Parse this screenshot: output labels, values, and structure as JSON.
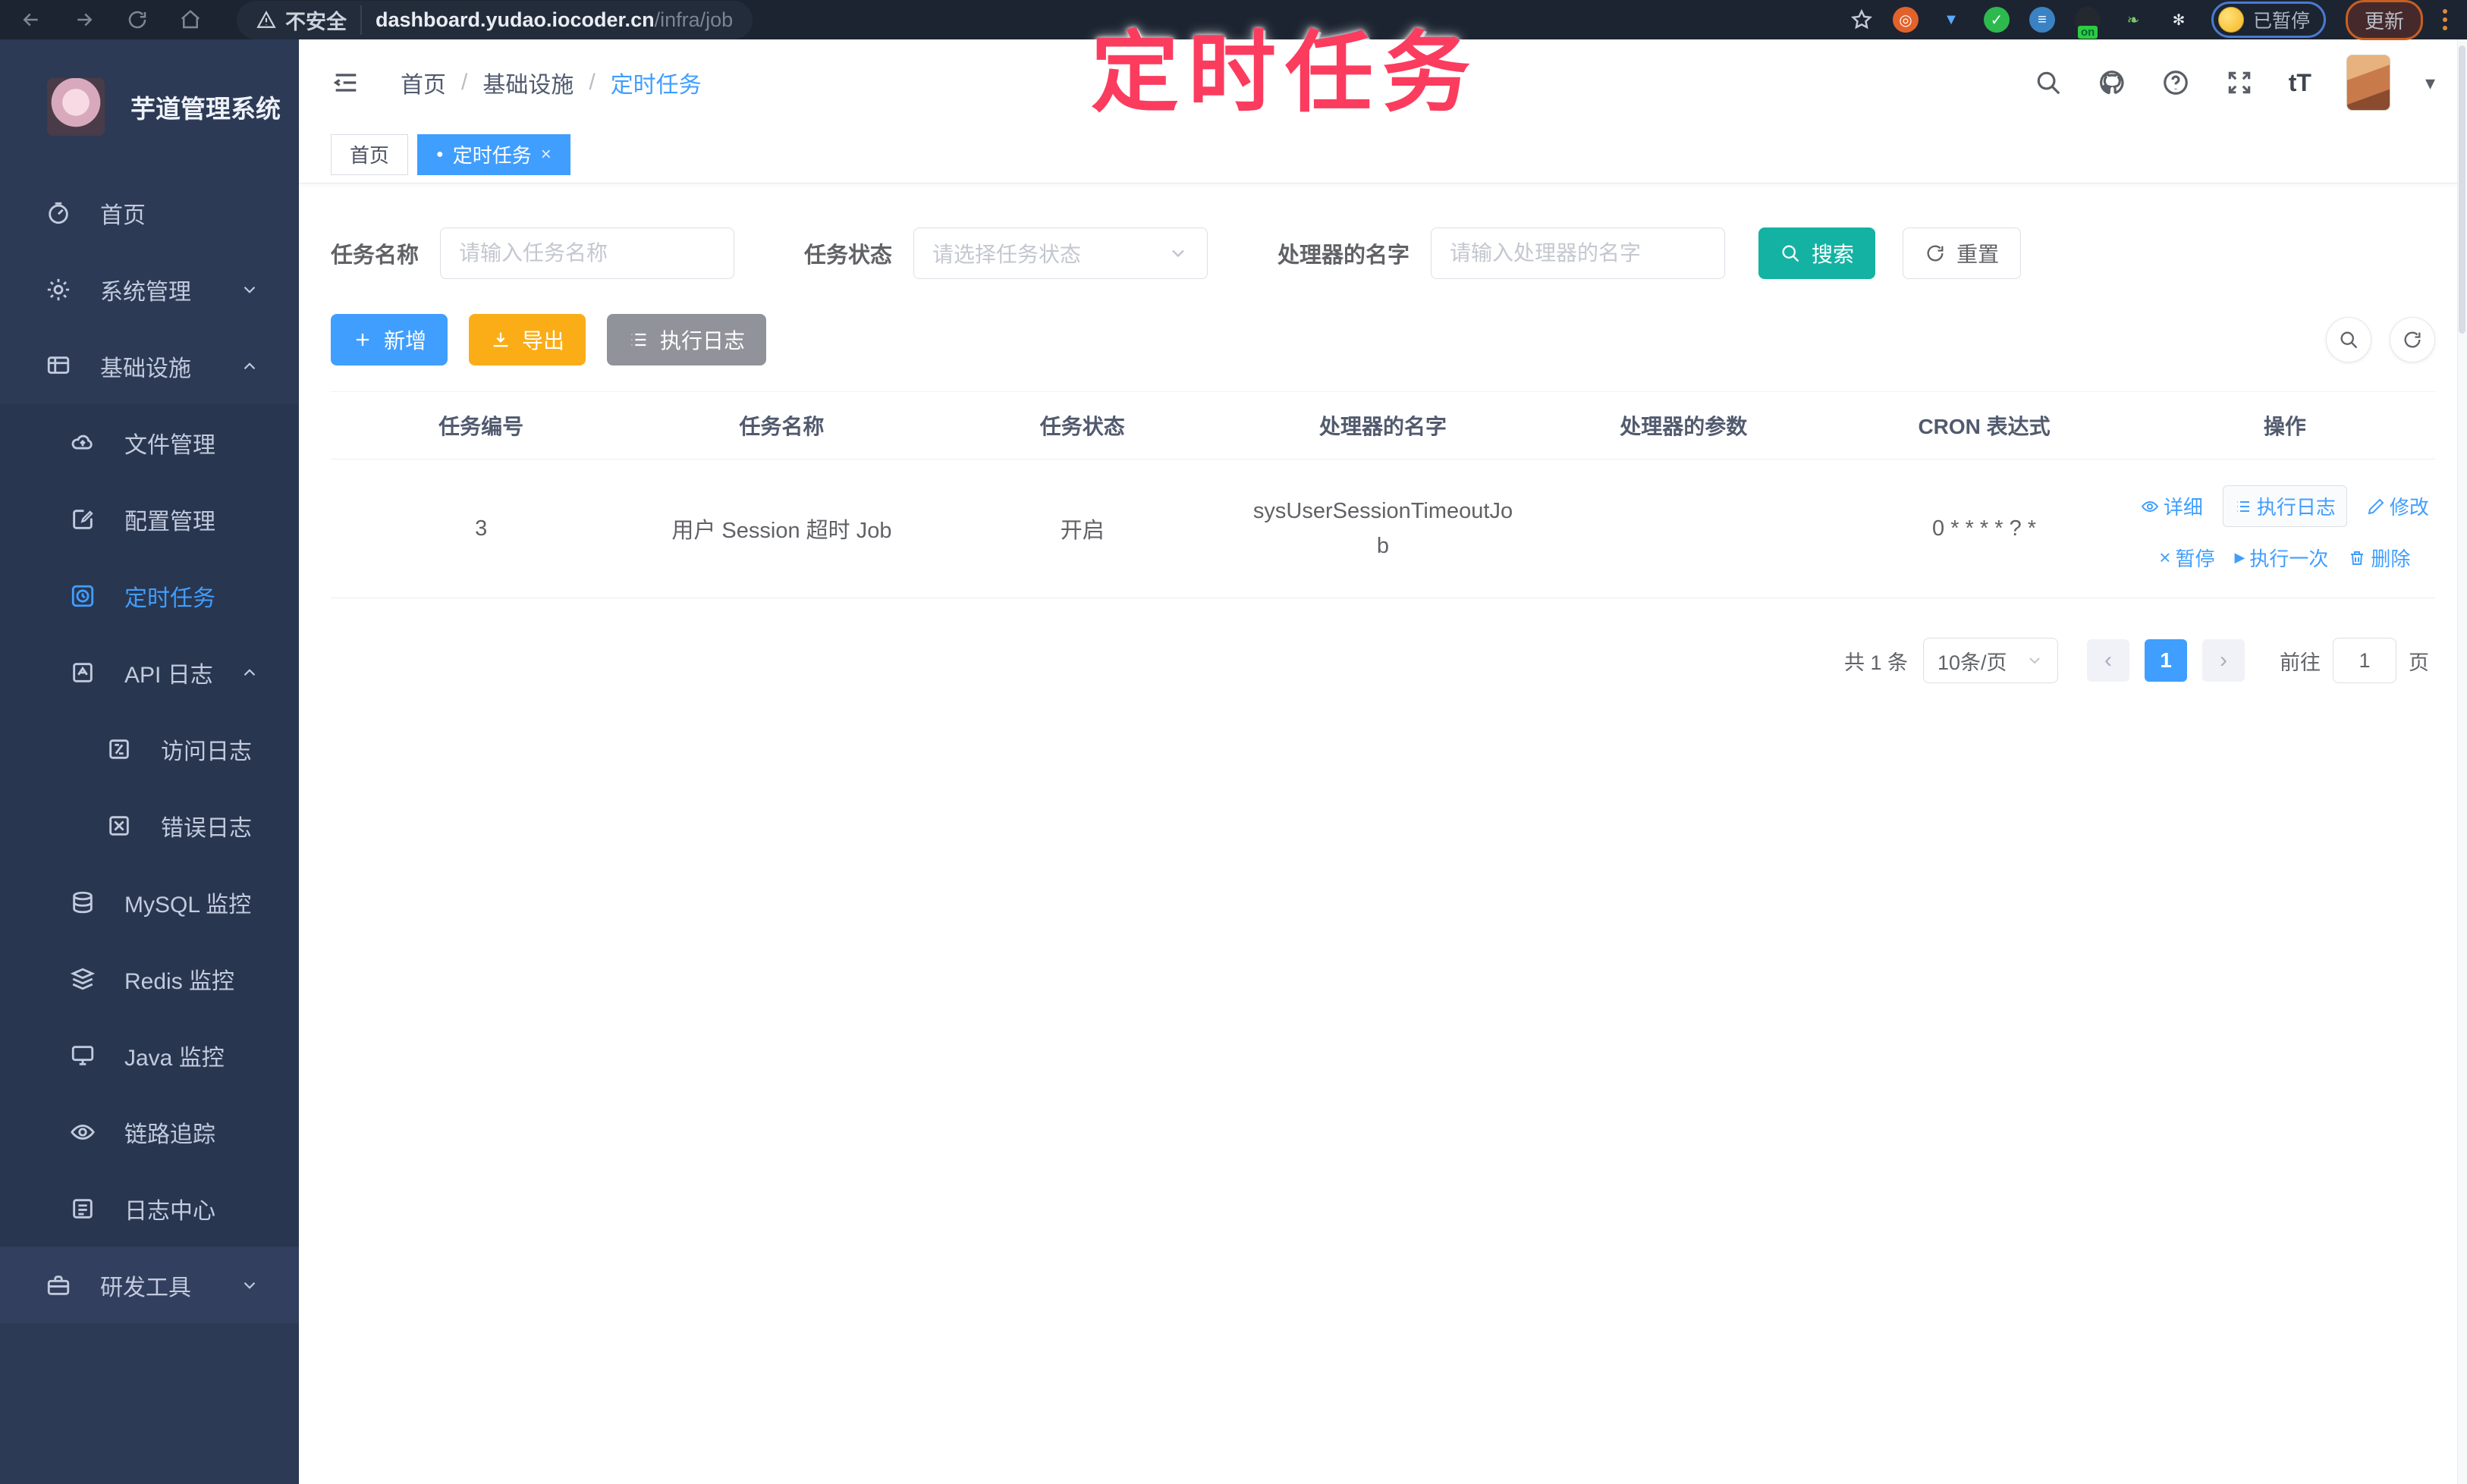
{
  "browser": {
    "security_label": "不安全",
    "url_host": "dashboard.yudao.iocoder.cn",
    "url_path": "/infra/job",
    "extension_badge": "on",
    "paused_label": "已暂停",
    "update_label": "更新"
  },
  "overlay": {
    "text": "定时任务"
  },
  "sidebar": {
    "title": "芋道管理系统",
    "items": [
      {
        "label": "首页"
      },
      {
        "label": "系统管理"
      },
      {
        "label": "基础设施"
      },
      {
        "label": "文件管理"
      },
      {
        "label": "配置管理"
      },
      {
        "label": "定时任务"
      },
      {
        "label": "API 日志"
      },
      {
        "label": "访问日志"
      },
      {
        "label": "错误日志"
      },
      {
        "label": "MySQL 监控"
      },
      {
        "label": "Redis 监控"
      },
      {
        "label": "Java 监控"
      },
      {
        "label": "链路追踪"
      },
      {
        "label": "日志中心"
      },
      {
        "label": "研发工具"
      }
    ]
  },
  "header": {
    "breadcrumb": [
      "首页",
      "基础设施",
      "定时任务"
    ],
    "breadcrumb_sep": "/"
  },
  "tabs": [
    {
      "label": "首页"
    },
    {
      "label": "定时任务"
    }
  ],
  "filters": {
    "name_label": "任务名称",
    "name_placeholder": "请输入任务名称",
    "status_label": "任务状态",
    "status_placeholder": "请选择任务状态",
    "handler_label": "处理器的名字",
    "handler_placeholder": "请输入处理器的名字",
    "search_label": "搜索",
    "reset_label": "重置"
  },
  "toolbar": {
    "add_label": "新增",
    "export_label": "导出",
    "log_label": "执行日志"
  },
  "table": {
    "columns": [
      "任务编号",
      "任务名称",
      "任务状态",
      "处理器的名字",
      "处理器的参数",
      "CRON 表达式",
      "操作"
    ],
    "rows": [
      {
        "id": "3",
        "name": "用户 Session 超时 Job",
        "status": "开启",
        "handler": "sysUserSessionTimeoutJob",
        "param": "",
        "cron": "0 * * * * ? *",
        "actions": [
          "详细",
          "执行日志",
          "修改",
          "暂停",
          "执行一次",
          "删除"
        ]
      }
    ]
  },
  "pagination": {
    "total": "共 1 条",
    "page_size": "10条/页",
    "page": "1",
    "goto_label": "前往",
    "goto_value": "1",
    "page_label": "页"
  },
  "icons": {
    "dot": "●",
    "close": "×",
    "caret_down": "▾",
    "prev": "‹",
    "next": "›",
    "pause": "×",
    "play": "▶",
    "font_size": "tT"
  },
  "colors": {
    "primary": "#409eff",
    "search_teal": "#14b2a2",
    "export_orange": "#fbad17",
    "info_gray": "#909399",
    "sidebar_bg": "#2c3a55",
    "overlay_pink": "#fb3c5e"
  }
}
